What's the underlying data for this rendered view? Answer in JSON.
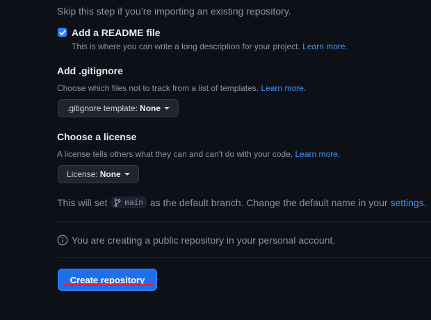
{
  "init": {
    "hint": "Skip this step if you’re importing an existing repository."
  },
  "readme": {
    "checked": true,
    "label": "Add a README file",
    "description": "This is where you can write a long description for your project.",
    "link": "Learn more."
  },
  "gitignore": {
    "title": "Add .gitignore",
    "description": "Choose which files not to track from a list of templates.",
    "link": "Learn more.",
    "select_prefix": ".gitignore template:",
    "select_value": "None"
  },
  "license": {
    "title": "Choose a license",
    "description": "A license tells others what they can and can't do with your code.",
    "link": "Learn more.",
    "select_prefix": "License:",
    "select_value": "None"
  },
  "branch": {
    "prefix": "This will set",
    "name": "main",
    "suffix": "as the default branch. Change the default name in your",
    "link": "settings",
    "end": "."
  },
  "info": {
    "text": "You are creating a public repository in your personal account."
  },
  "create_button": {
    "label": "Create repository"
  },
  "colors": {
    "background": "#0d1117",
    "accent": "#1f6feb",
    "link": "#4493f8",
    "annotation": "#e0233a"
  }
}
